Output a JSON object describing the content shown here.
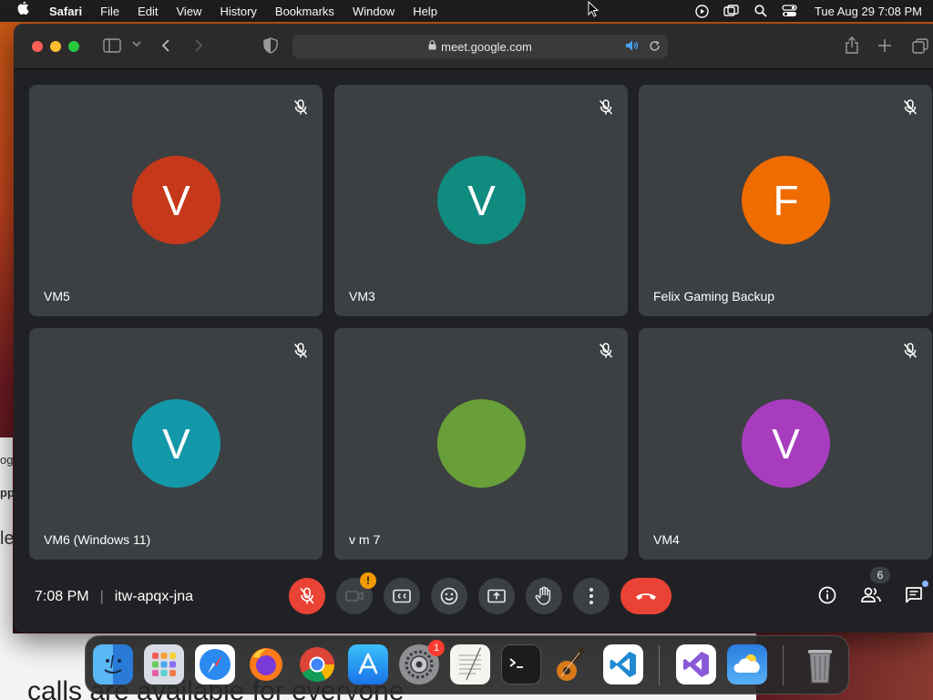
{
  "menubar": {
    "app_name": "Safari",
    "items": [
      "File",
      "Edit",
      "View",
      "History",
      "Bookmarks",
      "Window",
      "Help"
    ],
    "clock": "Tue Aug 29  7:08 PM",
    "status_icons": [
      "screen-recording-icon",
      "screen-mirroring-icon",
      "spotlight-search-icon",
      "control-center-icon"
    ]
  },
  "browser": {
    "url": "meet.google.com",
    "traffic_lights": [
      "close",
      "minimize",
      "zoom"
    ]
  },
  "participants": [
    {
      "name": "VM5",
      "initial": "V",
      "color": "#c5391a",
      "muted": true
    },
    {
      "name": "VM3",
      "initial": "V",
      "color": "#0f8b80",
      "muted": true
    },
    {
      "name": "Felix Gaming Backup",
      "initial": "F",
      "color": "#ef6c00",
      "muted": true
    },
    {
      "name": "VM6 (Windows 11)",
      "initial": "V",
      "color": "#1298a8",
      "muted": true
    },
    {
      "name": "v m 7",
      "initial": "",
      "color": "#689f38",
      "muted": true
    },
    {
      "name": "VM4",
      "initial": "V",
      "color": "#a83cbf",
      "muted": true
    }
  ],
  "meeting": {
    "time": "7:08 PM",
    "separator": "|",
    "code": "itw-apqx-jna",
    "people_count": "6",
    "camera_alert": "!"
  },
  "background": {
    "doc_text": "calls are available for everyone",
    "side_texts": [
      "og",
      "pp",
      "le"
    ]
  },
  "dock": {
    "apps": [
      "Finder",
      "Launchpad",
      "Safari",
      "Firefox",
      "Chrome",
      "App Store",
      "System Settings",
      "TextEdit",
      "Terminal",
      "GarageBand",
      "Visual Studio Code",
      "Visual Studio",
      "Weather",
      "Trash"
    ],
    "settings_badge": "1"
  }
}
